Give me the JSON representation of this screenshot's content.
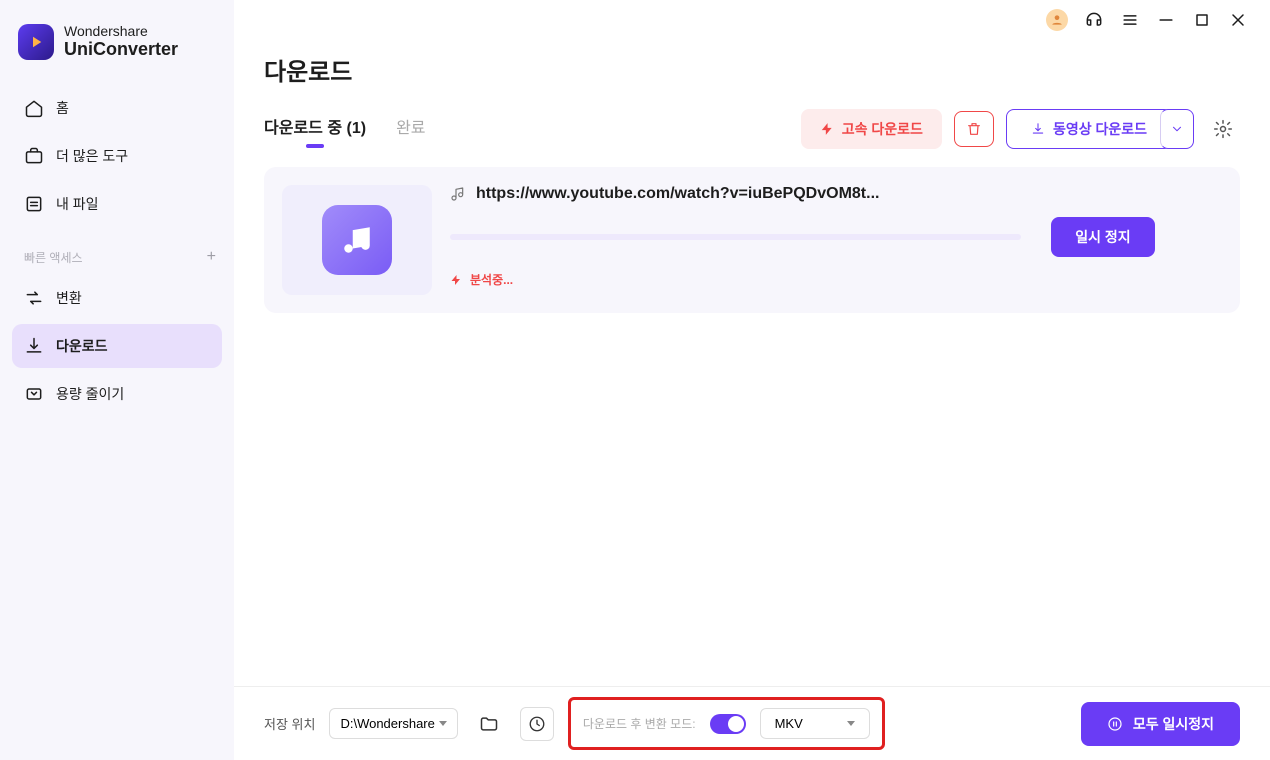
{
  "brand": {
    "line1": "Wondershare",
    "line2": "UniConverter"
  },
  "sidebar": {
    "home": "홈",
    "more_tools": "더 많은 도구",
    "my_files": "내 파일",
    "quick_access": "빠른 액세스",
    "convert": "변환",
    "download": "다운로드",
    "compress": "용량 줄이기"
  },
  "page": {
    "title": "다운로드"
  },
  "tabs": {
    "downloading_label": "다운로드 중",
    "downloading_count": "(1)",
    "done_label": "완료"
  },
  "actions": {
    "fast_download": "고속 다운로드",
    "video_download": "동영상 다운로드"
  },
  "item": {
    "url": "https://www.youtube.com/watch?v=iuBePQDvOM8t...",
    "pause": "일시 정지",
    "status": "분석중..."
  },
  "footer": {
    "save_to_label": "저장 위치",
    "save_to_path": "D:\\Wondershare",
    "convert_mode_label": "다운로드 후 변환 모드:",
    "format": "MKV",
    "pause_all": "모두 일시정지"
  }
}
